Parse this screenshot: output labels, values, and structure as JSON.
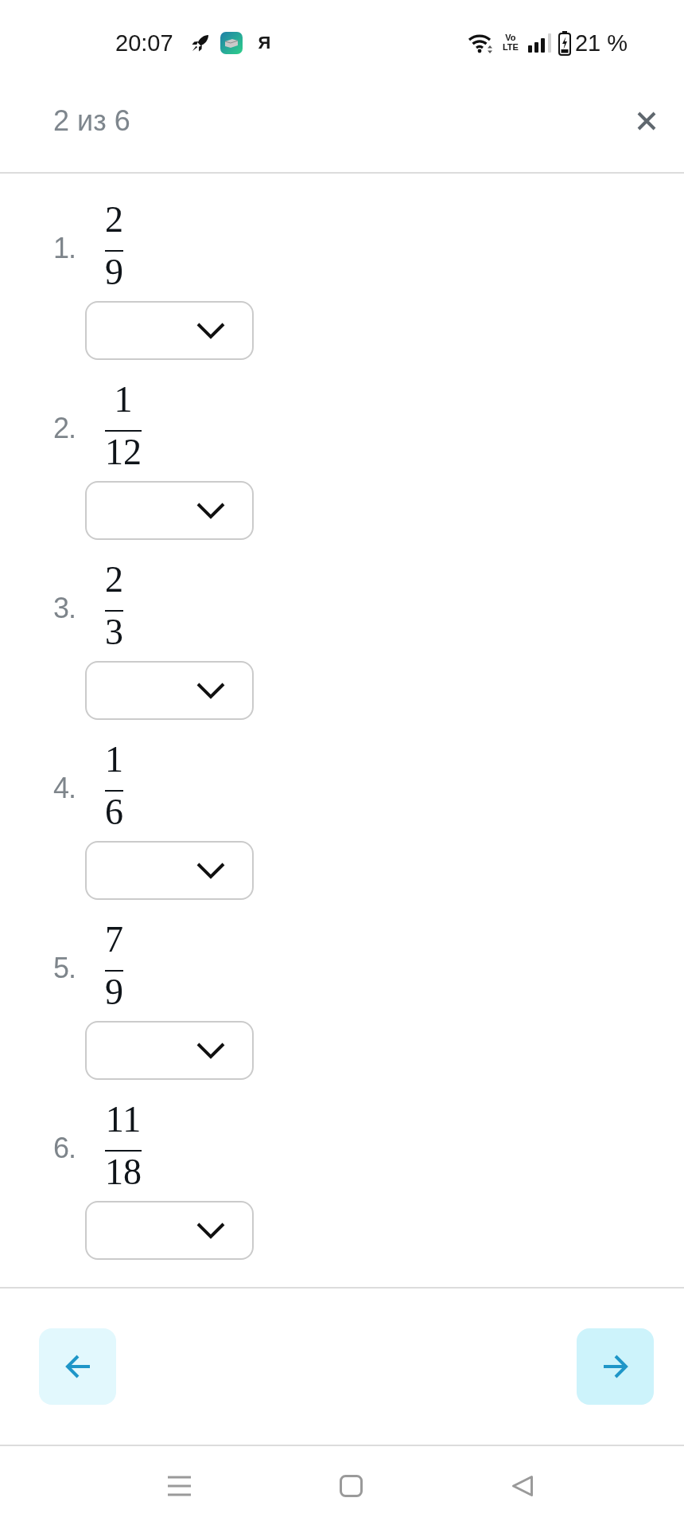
{
  "status_bar": {
    "time": "20:07",
    "notification_letter": "Я",
    "network_type": "Vo LTE",
    "battery_percent": "21 %"
  },
  "header": {
    "title": "2 из 6"
  },
  "questions": [
    {
      "number": "1.",
      "numerator": "2",
      "denominator": "9"
    },
    {
      "number": "2.",
      "numerator": "1",
      "denominator": "12"
    },
    {
      "number": "3.",
      "numerator": "2",
      "denominator": "3"
    },
    {
      "number": "4.",
      "numerator": "1",
      "denominator": "6"
    },
    {
      "number": "5.",
      "numerator": "7",
      "denominator": "9"
    },
    {
      "number": "6.",
      "numerator": "11",
      "denominator": "18"
    }
  ],
  "navigation": [
    {
      "kind": "previous"
    },
    {
      "kind": "next"
    }
  ]
}
